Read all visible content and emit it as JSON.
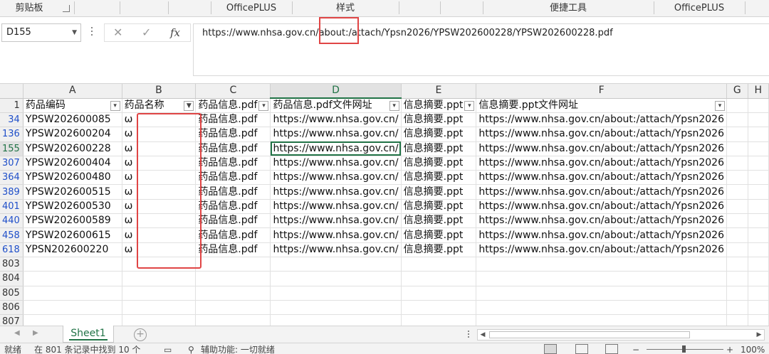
{
  "ribbon": {
    "groups": [
      {
        "label": "剪贴板"
      },
      {
        "label": "OfficePLUS"
      },
      {
        "label": "样式"
      },
      {
        "label": "便捷工具"
      },
      {
        "label": "OfficePLUS"
      }
    ]
  },
  "formula_bar": {
    "name_box": "D155",
    "cancel_icon": "✕",
    "enter_icon": "✓",
    "fx_label": "fx",
    "content": "https://www.nhsa.gov.cn/about:/attach/Ypsn2026/YPSW202600228/YPSW202600228.pdf"
  },
  "columns": [
    "A",
    "B",
    "C",
    "D",
    "E",
    "F",
    "G",
    "H"
  ],
  "header_row": {
    "row_number": "1",
    "cells": [
      "药品编码",
      "药品名称",
      "药品信息.pdf",
      "药品信息.pdf文件网址",
      "信息摘要.ppt",
      "信息摘要.ppt文件网址",
      "",
      ""
    ]
  },
  "rows": [
    {
      "row": "34",
      "cells": [
        "YPSW202600085",
        "ω",
        "药品信息.pdf",
        "https://www.nhsa.gov.cn/",
        "信息摘要.ppt",
        "https://www.nhsa.gov.cn/about:/attach/Ypsn2026",
        "",
        ""
      ]
    },
    {
      "row": "136",
      "cells": [
        "YPSW202600204",
        "ω",
        "药品信息.pdf",
        "https://www.nhsa.gov.cn/",
        "信息摘要.ppt",
        "https://www.nhsa.gov.cn/about:/attach/Ypsn2026",
        "",
        ""
      ]
    },
    {
      "row": "155",
      "cells": [
        "YPSW202600228",
        "ω",
        "药品信息.pdf",
        "https://www.nhsa.gov.cn/",
        "信息摘要.ppt",
        "https://www.nhsa.gov.cn/about:/attach/Ypsn2026",
        "",
        ""
      ]
    },
    {
      "row": "307",
      "cells": [
        "YPSW202600404",
        "ω",
        "药品信息.pdf",
        "https://www.nhsa.gov.cn/",
        "信息摘要.ppt",
        "https://www.nhsa.gov.cn/about:/attach/Ypsn2026",
        "",
        ""
      ]
    },
    {
      "row": "364",
      "cells": [
        "YPSW202600480",
        "ω",
        "药品信息.pdf",
        "https://www.nhsa.gov.cn/",
        "信息摘要.ppt",
        "https://www.nhsa.gov.cn/about:/attach/Ypsn2026",
        "",
        ""
      ]
    },
    {
      "row": "389",
      "cells": [
        "YPSW202600515",
        "ω",
        "药品信息.pdf",
        "https://www.nhsa.gov.cn/",
        "信息摘要.ppt",
        "https://www.nhsa.gov.cn/about:/attach/Ypsn2026",
        "",
        ""
      ]
    },
    {
      "row": "401",
      "cells": [
        "YPSW202600530",
        "ω",
        "药品信息.pdf",
        "https://www.nhsa.gov.cn/",
        "信息摘要.ppt",
        "https://www.nhsa.gov.cn/about:/attach/Ypsn2026",
        "",
        ""
      ]
    },
    {
      "row": "440",
      "cells": [
        "YPSW202600589",
        "ω",
        "药品信息.pdf",
        "https://www.nhsa.gov.cn/",
        "信息摘要.ppt",
        "https://www.nhsa.gov.cn/about:/attach/Ypsn2026",
        "",
        ""
      ]
    },
    {
      "row": "458",
      "cells": [
        "YPSW202600615",
        "ω",
        "药品信息.pdf",
        "https://www.nhsa.gov.cn/",
        "信息摘要.ppt",
        "https://www.nhsa.gov.cn/about:/attach/Ypsn2026",
        "",
        ""
      ]
    },
    {
      "row": "618",
      "cells": [
        "YPSN202600220",
        "ω",
        "药品信息.pdf",
        "https://www.nhsa.gov.cn/",
        "信息摘要.ppt",
        "https://www.nhsa.gov.cn/about:/attach/Ypsn2026",
        "",
        ""
      ]
    }
  ],
  "empty_rows": [
    "803",
    "804",
    "805",
    "806",
    "807"
  ],
  "active_cell": {
    "row": "155",
    "column": "D"
  },
  "sheet_tabs": {
    "active": "Sheet1",
    "add_icon": "+"
  },
  "status_bar": {
    "ready": "就绪",
    "filter_result": "在 801 条记录中找到 10 个",
    "accessibility": "辅助功能: 一切就绪",
    "zoom": "100%"
  },
  "colors": {
    "excel_green": "#217346",
    "annotation_red": "#e04545",
    "row_number_blue": "#1f4fc9"
  }
}
